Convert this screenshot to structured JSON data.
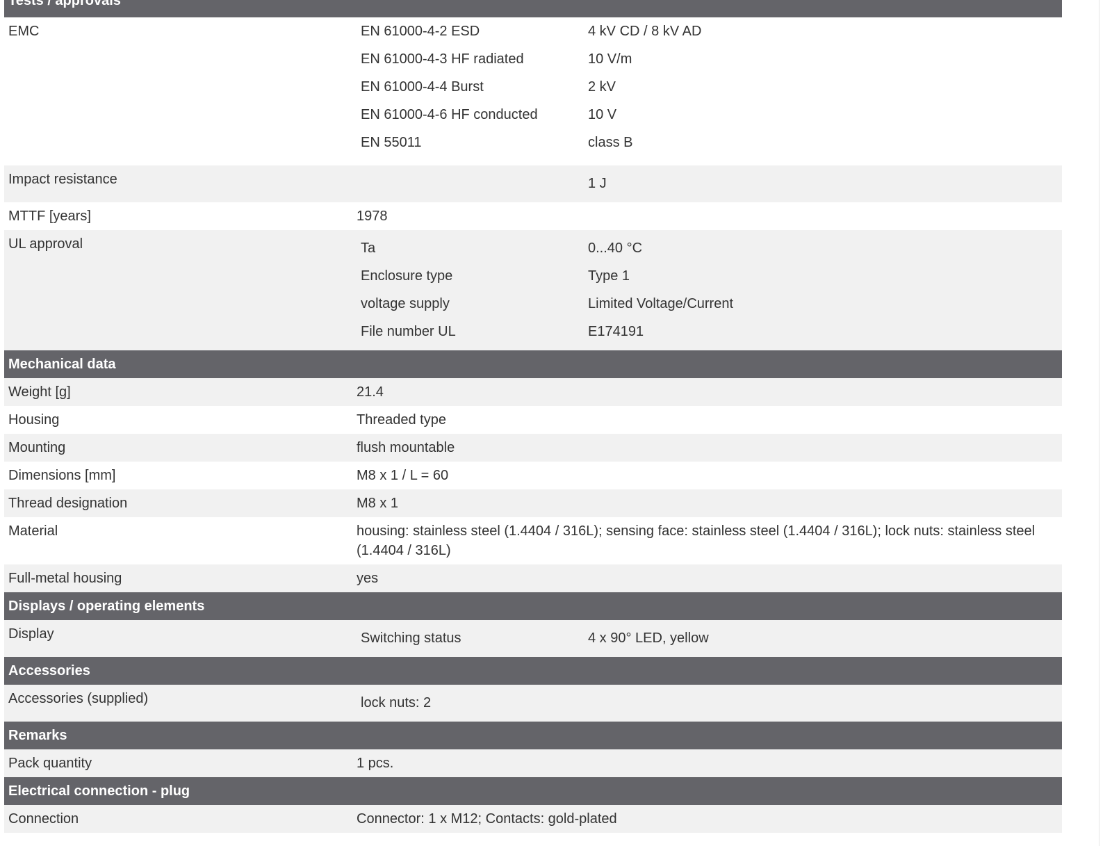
{
  "sections": {
    "tests": {
      "title": "Tests / approvals",
      "emc": {
        "label": "EMC",
        "items": [
          {
            "key": "EN 61000-4-2 ESD",
            "value": "4 kV CD / 8 kV AD"
          },
          {
            "key": "EN 61000-4-3 HF radiated",
            "value": "10 V/m"
          },
          {
            "key": "EN 61000-4-4 Burst",
            "value": "2 kV"
          },
          {
            "key": "EN 61000-4-6 HF conducted",
            "value": "10 V"
          },
          {
            "key": "EN 55011",
            "value": "class B"
          }
        ]
      },
      "impact": {
        "label": "Impact resistance",
        "value": "1 J"
      },
      "mttf": {
        "label": "MTTF [years]",
        "value": "1978"
      },
      "ul": {
        "label": "UL approval",
        "items": [
          {
            "key": "Ta",
            "value": "0...40 °C"
          },
          {
            "key": "Enclosure type",
            "value": "Type 1"
          },
          {
            "key": "voltage supply",
            "value": "Limited Voltage/Current"
          },
          {
            "key": "File number UL",
            "value": "E174191"
          }
        ]
      }
    },
    "mechanical": {
      "title": "Mechanical data",
      "rows": [
        {
          "label": "Weight [g]",
          "value": "21.4"
        },
        {
          "label": "Housing",
          "value": "Threaded type"
        },
        {
          "label": "Mounting",
          "value": "flush mountable"
        },
        {
          "label": "Dimensions [mm]",
          "value": "M8 x 1 / L = 60"
        },
        {
          "label": "Thread designation",
          "value": "M8 x 1"
        },
        {
          "label": "Material",
          "value": "housing: stainless steel (1.4404 / 316L); sensing face: stainless steel (1.4404 / 316L); lock nuts: stainless steel (1.4404 / 316L)"
        },
        {
          "label": "Full-metal housing",
          "value": "yes"
        }
      ]
    },
    "displays": {
      "title": "Displays / operating elements",
      "display": {
        "label": "Display",
        "key": "Switching status",
        "value": "4 x 90° LED, yellow"
      }
    },
    "accessories": {
      "title": "Accessories",
      "supplied": {
        "label": "Accessories (supplied)",
        "value": "lock nuts: 2"
      }
    },
    "remarks": {
      "title": "Remarks",
      "pack": {
        "label": "Pack quantity",
        "value": "1 pcs."
      }
    },
    "electrical": {
      "title": "Electrical connection - plug",
      "connection": {
        "label": "Connection",
        "value": "Connector: 1 x M12; Contacts: gold-plated"
      }
    }
  }
}
